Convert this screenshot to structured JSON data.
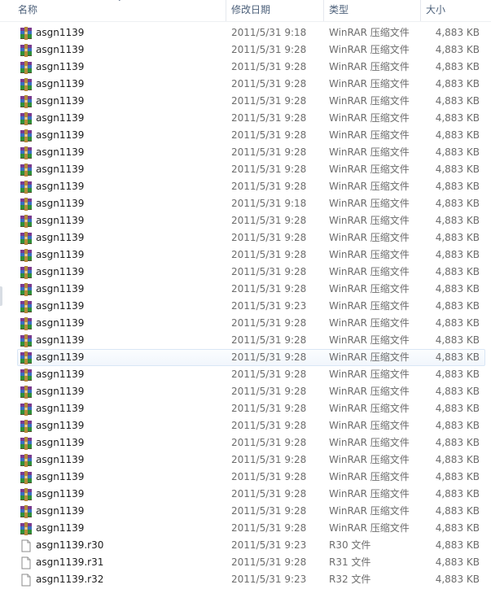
{
  "columns": {
    "name": "名称",
    "date": "修改日期",
    "type": "类型",
    "size": "大小"
  },
  "icons": {
    "archive": "winrar-archive-icon",
    "file": "blank-file-icon",
    "sort": "chevron-down-icon"
  },
  "files": [
    {
      "name": "asgn1139",
      "date": "2011/5/31 9:18",
      "type": "WinRAR 压缩文件",
      "size": "4,883 KB",
      "icon": "archive"
    },
    {
      "name": "asgn1139",
      "date": "2011/5/31 9:28",
      "type": "WinRAR 压缩文件",
      "size": "4,883 KB",
      "icon": "archive"
    },
    {
      "name": "asgn1139",
      "date": "2011/5/31 9:28",
      "type": "WinRAR 压缩文件",
      "size": "4,883 KB",
      "icon": "archive"
    },
    {
      "name": "asgn1139",
      "date": "2011/5/31 9:28",
      "type": "WinRAR 压缩文件",
      "size": "4,883 KB",
      "icon": "archive"
    },
    {
      "name": "asgn1139",
      "date": "2011/5/31 9:28",
      "type": "WinRAR 压缩文件",
      "size": "4,883 KB",
      "icon": "archive"
    },
    {
      "name": "asgn1139",
      "date": "2011/5/31 9:28",
      "type": "WinRAR 压缩文件",
      "size": "4,883 KB",
      "icon": "archive"
    },
    {
      "name": "asgn1139",
      "date": "2011/5/31 9:28",
      "type": "WinRAR 压缩文件",
      "size": "4,883 KB",
      "icon": "archive"
    },
    {
      "name": "asgn1139",
      "date": "2011/5/31 9:28",
      "type": "WinRAR 压缩文件",
      "size": "4,883 KB",
      "icon": "archive"
    },
    {
      "name": "asgn1139",
      "date": "2011/5/31 9:28",
      "type": "WinRAR 压缩文件",
      "size": "4,883 KB",
      "icon": "archive"
    },
    {
      "name": "asgn1139",
      "date": "2011/5/31 9:28",
      "type": "WinRAR 压缩文件",
      "size": "4,883 KB",
      "icon": "archive"
    },
    {
      "name": "asgn1139",
      "date": "2011/5/31 9:18",
      "type": "WinRAR 压缩文件",
      "size": "4,883 KB",
      "icon": "archive"
    },
    {
      "name": "asgn1139",
      "date": "2011/5/31 9:28",
      "type": "WinRAR 压缩文件",
      "size": "4,883 KB",
      "icon": "archive"
    },
    {
      "name": "asgn1139",
      "date": "2011/5/31 9:28",
      "type": "WinRAR 压缩文件",
      "size": "4,883 KB",
      "icon": "archive"
    },
    {
      "name": "asgn1139",
      "date": "2011/5/31 9:28",
      "type": "WinRAR 压缩文件",
      "size": "4,883 KB",
      "icon": "archive"
    },
    {
      "name": "asgn1139",
      "date": "2011/5/31 9:28",
      "type": "WinRAR 压缩文件",
      "size": "4,883 KB",
      "icon": "archive"
    },
    {
      "name": "asgn1139",
      "date": "2011/5/31 9:28",
      "type": "WinRAR 压缩文件",
      "size": "4,883 KB",
      "icon": "archive"
    },
    {
      "name": "asgn1139",
      "date": "2011/5/31 9:23",
      "type": "WinRAR 压缩文件",
      "size": "4,883 KB",
      "icon": "archive"
    },
    {
      "name": "asgn1139",
      "date": "2011/5/31 9:28",
      "type": "WinRAR 压缩文件",
      "size": "4,883 KB",
      "icon": "archive"
    },
    {
      "name": "asgn1139",
      "date": "2011/5/31 9:28",
      "type": "WinRAR 压缩文件",
      "size": "4,883 KB",
      "icon": "archive"
    },
    {
      "name": "asgn1139",
      "date": "2011/5/31 9:28",
      "type": "WinRAR 压缩文件",
      "size": "4,883 KB",
      "icon": "archive",
      "selected": true
    },
    {
      "name": "asgn1139",
      "date": "2011/5/31 9:28",
      "type": "WinRAR 压缩文件",
      "size": "4,883 KB",
      "icon": "archive"
    },
    {
      "name": "asgn1139",
      "date": "2011/5/31 9:28",
      "type": "WinRAR 压缩文件",
      "size": "4,883 KB",
      "icon": "archive"
    },
    {
      "name": "asgn1139",
      "date": "2011/5/31 9:28",
      "type": "WinRAR 压缩文件",
      "size": "4,883 KB",
      "icon": "archive"
    },
    {
      "name": "asgn1139",
      "date": "2011/5/31 9:28",
      "type": "WinRAR 压缩文件",
      "size": "4,883 KB",
      "icon": "archive"
    },
    {
      "name": "asgn1139",
      "date": "2011/5/31 9:28",
      "type": "WinRAR 压缩文件",
      "size": "4,883 KB",
      "icon": "archive"
    },
    {
      "name": "asgn1139",
      "date": "2011/5/31 9:28",
      "type": "WinRAR 压缩文件",
      "size": "4,883 KB",
      "icon": "archive"
    },
    {
      "name": "asgn1139",
      "date": "2011/5/31 9:28",
      "type": "WinRAR 压缩文件",
      "size": "4,883 KB",
      "icon": "archive"
    },
    {
      "name": "asgn1139",
      "date": "2011/5/31 9:28",
      "type": "WinRAR 压缩文件",
      "size": "4,883 KB",
      "icon": "archive"
    },
    {
      "name": "asgn1139",
      "date": "2011/5/31 9:28",
      "type": "WinRAR 压缩文件",
      "size": "4,883 KB",
      "icon": "archive"
    },
    {
      "name": "asgn1139",
      "date": "2011/5/31 9:28",
      "type": "WinRAR 压缩文件",
      "size": "4,883 KB",
      "icon": "archive"
    },
    {
      "name": "asgn1139.r30",
      "date": "2011/5/31 9:23",
      "type": "R30 文件",
      "size": "4,883 KB",
      "icon": "file"
    },
    {
      "name": "asgn1139.r31",
      "date": "2011/5/31 9:28",
      "type": "R31 文件",
      "size": "4,883 KB",
      "icon": "file"
    },
    {
      "name": "asgn1139.r32",
      "date": "2011/5/31 9:23",
      "type": "R32 文件",
      "size": "4,883 KB",
      "icon": "file"
    }
  ]
}
